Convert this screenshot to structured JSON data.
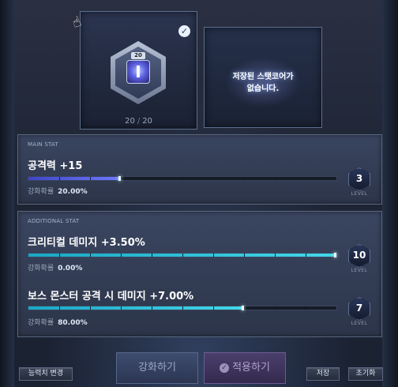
{
  "core_slot": {
    "level": "20",
    "count_current": "20",
    "count_separator": "/",
    "count_max": "20",
    "icon": "stat-core-icon"
  },
  "saved_slot": {
    "empty_line1": "저장된 스탯코어가",
    "empty_line2": "없습니다."
  },
  "main_stat": {
    "section_label": "MAIN STAT",
    "name": "공격력 +15",
    "rate_label": "강화확률",
    "rate_value": "20.00%",
    "progress": 0.3,
    "level": "3",
    "level_label": "LEVEL"
  },
  "additional_stat": {
    "section_label": "ADDITIONAL STAT",
    "items": [
      {
        "name": "크리티컬 데미지 +3.50%",
        "rate_label": "강화확률",
        "rate_value": "0.00%",
        "progress": 1.0,
        "level": "10",
        "level_label": "LEVEL"
      },
      {
        "name": "보스 몬스터 공격 시 데미지 +7.00%",
        "rate_label": "강화확률",
        "rate_value": "80.00%",
        "progress": 0.7,
        "level": "7",
        "level_label": "LEVEL"
      }
    ]
  },
  "buttons": {
    "reset": "능력치 변경",
    "enhance": "강화하기",
    "apply": "적용하기",
    "save": "저장",
    "init": "초기화"
  },
  "colors": {
    "main_bar": "#5a62e8",
    "additional_bar": "#2fc3dc",
    "panel_border": "#5a6880"
  }
}
